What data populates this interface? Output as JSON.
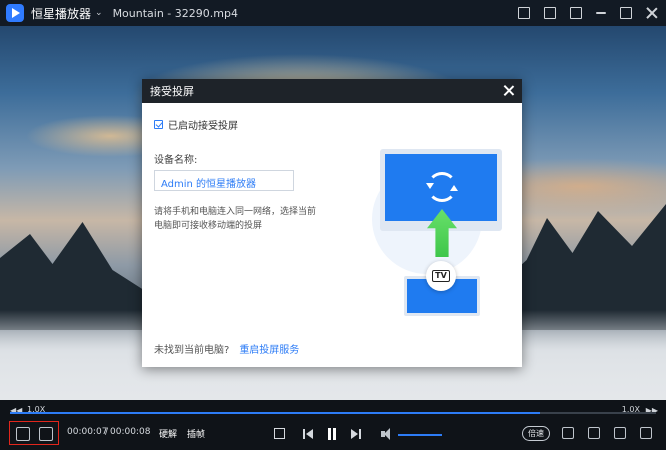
{
  "titlebar": {
    "app_name": "恒星播放器",
    "file_title": "Mountain - 32290.mp4"
  },
  "dialog": {
    "title": "接受投屏",
    "checkbox_label": "已启动接受投屏",
    "checkbox_checked": true,
    "device_name_label": "设备名称:",
    "device_name_value": "Admin 的恒星播放器",
    "hint": "请将手机和电脑连入同一网络，选择当前电脑即可接收移动端的投屏",
    "footer_question": "未找到当前电脑?",
    "footer_link": "重启投屏服务",
    "tv_badge": "TV"
  },
  "progress": {
    "speed_left": "1.0X",
    "speed_right": "1.0X",
    "played_fraction": 0.82
  },
  "controls": {
    "time_current": "00:00:07",
    "time_separator": "/",
    "time_total": "00:00:08",
    "hw_decode_label": "硬解",
    "frame_interp_label": "插帧",
    "speed_label": "倍速",
    "volume_fraction": 1.0
  },
  "colors": {
    "accent": "#2d7cf6",
    "highlight_box": "#e1261c",
    "dialog_header": "#1e2329"
  },
  "icons": {
    "logo": "player-logo-icon",
    "cast_left": "screen-cast-icon",
    "cast_right": "screen-receive-icon"
  }
}
